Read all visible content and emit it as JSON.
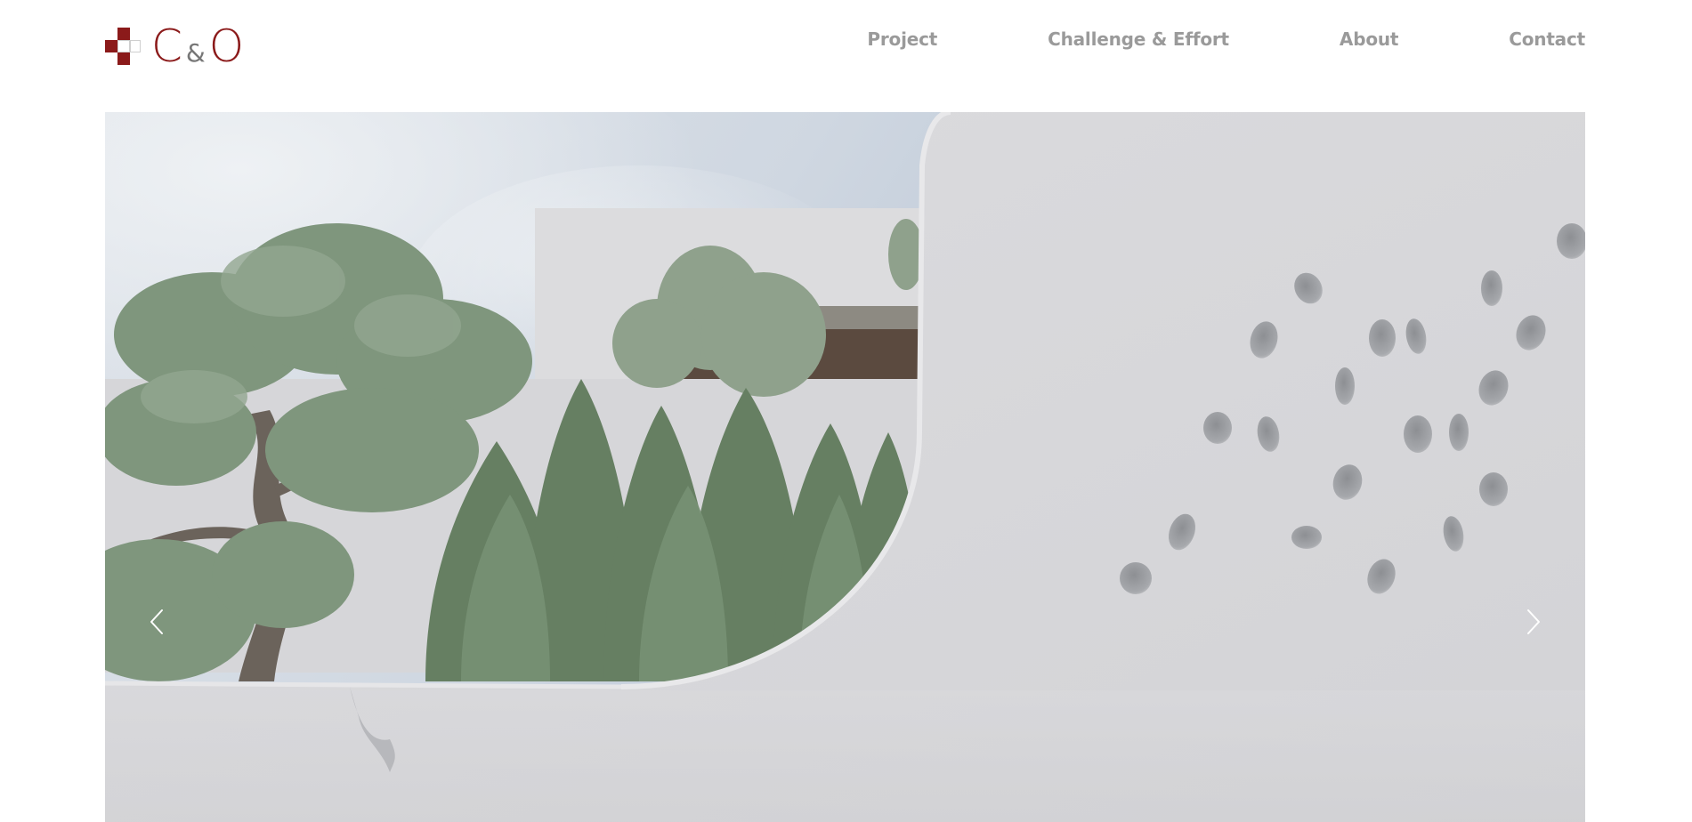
{
  "header": {
    "logo": {
      "letter_c": "C",
      "ampersand": "&",
      "letter_o": "O",
      "brand_color": "#8b1a1a",
      "ampersand_color": "#777777"
    },
    "nav": [
      {
        "label": "Project"
      },
      {
        "label": "Challenge & Effort"
      },
      {
        "label": "About"
      },
      {
        "label": "Contact"
      }
    ],
    "nav_color": "#9a9a9a"
  },
  "slider": {
    "prev_icon": "chevron-left-icon",
    "next_icon": "chevron-right-icon",
    "arrow_color": "#ffffff",
    "image_subject": "white curved wall with pebble-shaped openings, pine tree and cypress shrubs"
  }
}
